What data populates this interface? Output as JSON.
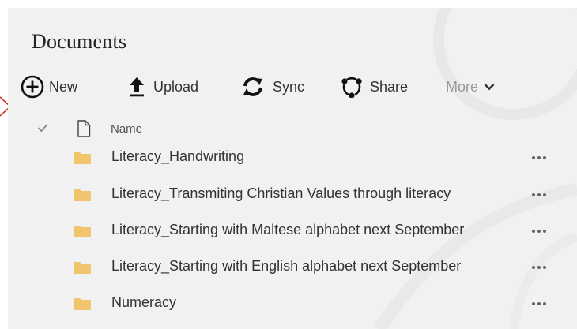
{
  "library": {
    "title": "Documents"
  },
  "toolbar": {
    "new_label": "New",
    "upload_label": "Upload",
    "sync_label": "Sync",
    "share_label": "Share",
    "more_label": "More"
  },
  "list": {
    "column_name": "Name",
    "rows": [
      {
        "name": "Literacy_Handwriting",
        "type": "folder"
      },
      {
        "name": "Literacy_Transmiting Christian Values through literacy",
        "type": "folder"
      },
      {
        "name": "Literacy_Starting with Maltese alphabet next September",
        "type": "folder"
      },
      {
        "name": "Literacy_Starting with English alphabet next September",
        "type": "folder"
      },
      {
        "name": "Numeracy",
        "type": "folder"
      }
    ]
  },
  "colors": {
    "panel_background": "#f1f1f1",
    "folder": "#f0c56d",
    "text": "#333333",
    "muted": "#9a9a9a",
    "arrow": "#d9352b"
  },
  "icons": {
    "new": "plus-circle-icon",
    "upload": "upload-arrow-icon",
    "sync": "sync-icon",
    "share": "share-icon",
    "more": "chevron-down-icon",
    "select_all": "checkmark-icon",
    "file_type": "document-icon",
    "item": "folder-icon",
    "item_actions": "ellipsis-icon"
  }
}
